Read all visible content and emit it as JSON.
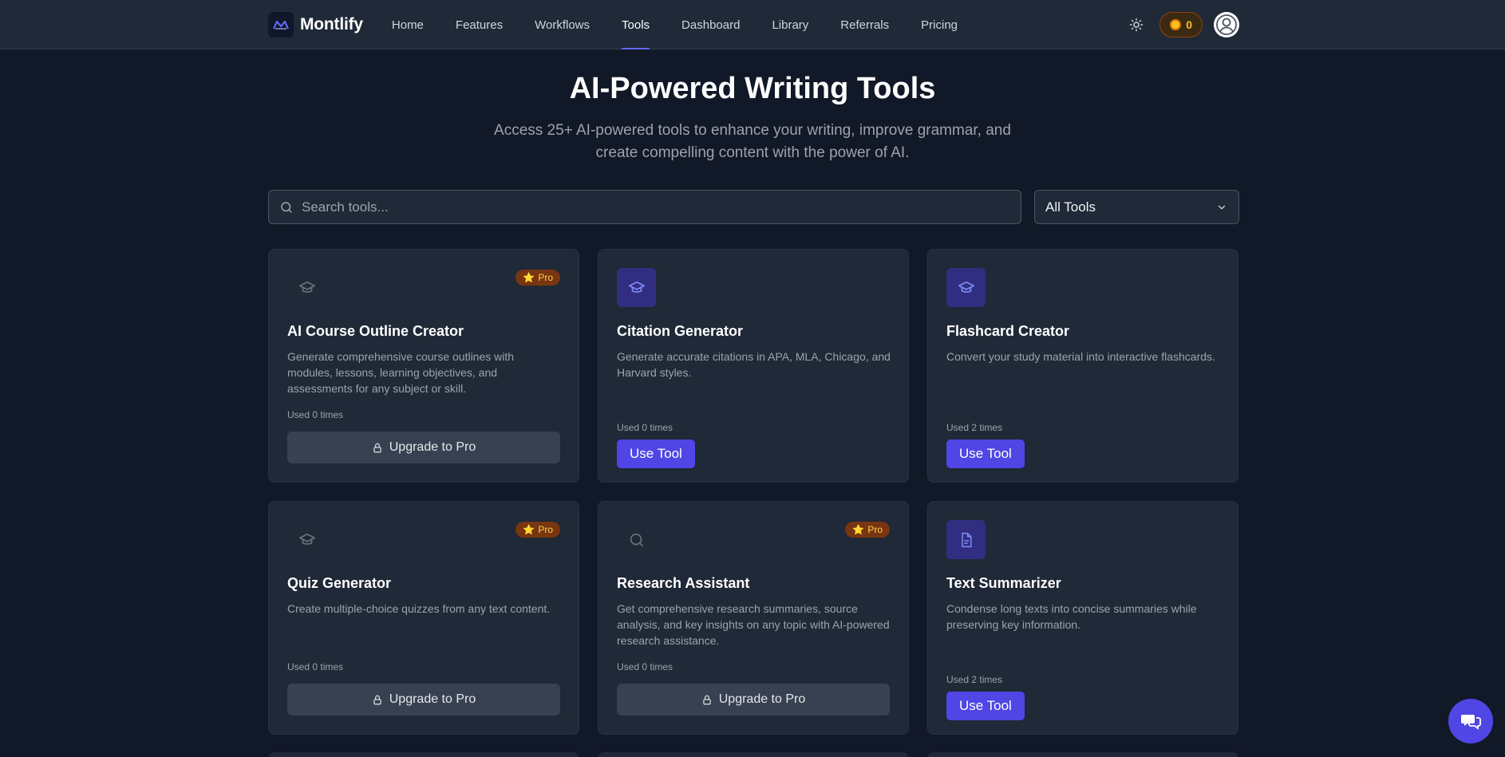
{
  "app": {
    "name": "Montlify",
    "credits": "0"
  },
  "nav": {
    "links": [
      {
        "label": "Home"
      },
      {
        "label": "Features"
      },
      {
        "label": "Workflows"
      },
      {
        "label": "Tools",
        "active": true
      },
      {
        "label": "Dashboard"
      },
      {
        "label": "Library"
      },
      {
        "label": "Referrals"
      },
      {
        "label": "Pricing"
      }
    ]
  },
  "hero": {
    "title": "AI-Powered Writing Tools",
    "subtitle": "Access 25+ AI-powered tools to enhance your writing, improve grammar, and create compelling content with the power of AI."
  },
  "search": {
    "placeholder": "Search tools...",
    "value": ""
  },
  "filter": {
    "selected": "All Tools"
  },
  "badges": {
    "pro": "Pro"
  },
  "buttons": {
    "upgrade": "Upgrade to Pro",
    "use": "Use Tool"
  },
  "colors": {
    "accent": "#4f46e5",
    "pro_badge": "#78350f",
    "background": "#111827",
    "card": "#1f2937"
  },
  "tools": [
    {
      "name": "AI Course Outline Creator",
      "description": "Generate comprehensive course outlines with modules, lessons, learning objectives, and assessments for any subject or skill.",
      "usage": "Used 0 times",
      "icon": "graduation-cap-icon",
      "pro": true
    },
    {
      "name": "Citation Generator",
      "description": "Generate accurate citations in APA, MLA, Chicago, and Harvard styles.",
      "usage": "Used 0 times",
      "icon": "graduation-cap-icon",
      "pro": false
    },
    {
      "name": "Flashcard Creator",
      "description": "Convert your study material into interactive flashcards.",
      "usage": "Used 2 times",
      "icon": "graduation-cap-icon",
      "pro": false
    },
    {
      "name": "Quiz Generator",
      "description": "Create multiple-choice quizzes from any text content.",
      "usage": "Used 0 times",
      "icon": "graduation-cap-icon",
      "pro": true
    },
    {
      "name": "Research Assistant",
      "description": "Get comprehensive research summaries, source analysis, and key insights on any topic with AI-powered research assistance.",
      "usage": "Used 0 times",
      "icon": "search-icon",
      "pro": true
    },
    {
      "name": "Text Summarizer",
      "description": "Condense long texts into concise summaries while preserving key information.",
      "usage": "Used 2 times",
      "icon": "document-icon",
      "pro": false
    }
  ]
}
